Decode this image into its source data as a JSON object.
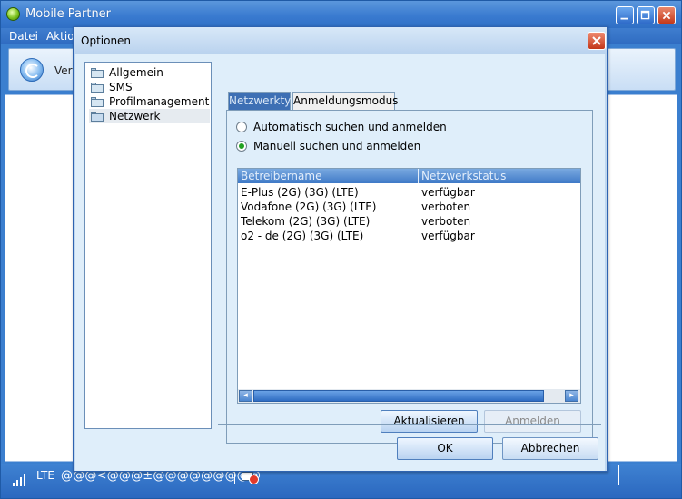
{
  "main_window": {
    "title": "Mobile Partner",
    "menu": [
      "Datei",
      "Aktion"
    ],
    "toolbar_label": "Verb",
    "status": {
      "network_type": "LTE",
      "operator_text": "@@@<@@@±@@@@@@@@@"
    }
  },
  "dialog": {
    "title": "Optionen",
    "tree": [
      {
        "label": "Allgemein"
      },
      {
        "label": "SMS"
      },
      {
        "label": "Profilmanagement"
      },
      {
        "label": "Netzwerk"
      }
    ],
    "tabs": [
      "Netzwerktyp",
      "Anmeldungsmodus"
    ],
    "radio_options": [
      {
        "label": "Automatisch suchen und anmelden",
        "checked": false
      },
      {
        "label": "Manuell suchen und anmelden",
        "checked": true
      }
    ],
    "network_table": {
      "columns": [
        "Betreibername",
        "Netzwerkstatus"
      ],
      "rows": [
        {
          "name": "E-Plus (2G) (3G) (LTE)",
          "status": "verfügbar"
        },
        {
          "name": "Vodafone (2G) (3G) (LTE)",
          "status": "verboten"
        },
        {
          "name": "Telekom (2G) (3G) (LTE)",
          "status": "verboten"
        },
        {
          "name": "o2 - de (2G) (3G) (LTE)",
          "status": "verfügbar"
        }
      ]
    },
    "buttons": {
      "refresh": "Aktualisieren",
      "register": "Anmelden",
      "ok": "OK",
      "cancel": "Abbrechen"
    }
  }
}
